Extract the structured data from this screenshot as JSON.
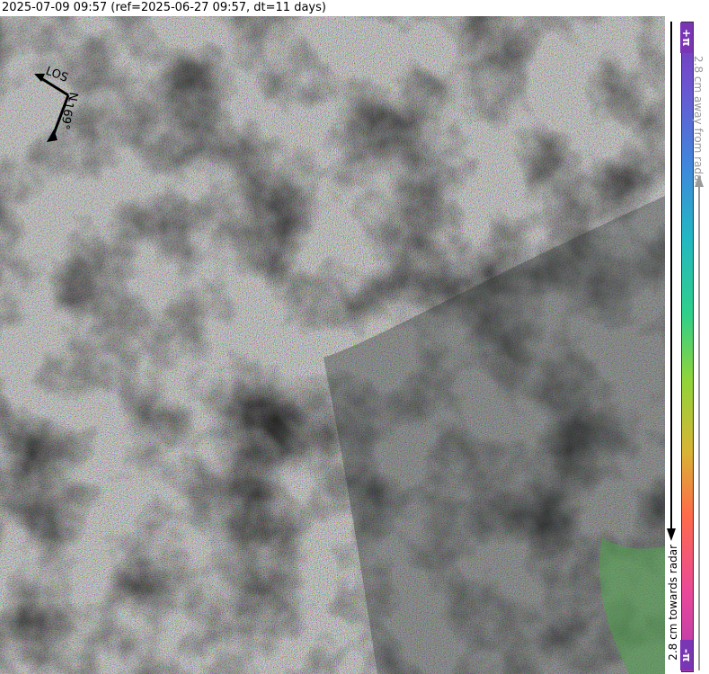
{
  "title": "2025-07-09 09:57 (ref=2025-06-27 09:57, dt=11 days)",
  "compass": {
    "los_label": "LOS",
    "north_label": "N",
    "heading_label": "-169°"
  },
  "colorbar": {
    "top_label": "+π",
    "bottom_label": "-π",
    "away_label": "2.8 cm away from radar",
    "towards_label": "2.8 cm towards radar",
    "top_color": "#7a35b5",
    "bottom_color": "#7a35b5",
    "away_arrow_color": "#9a9a9a",
    "towards_arrow_color": "#000000"
  },
  "map": {
    "description_color_base": "#5a5f58",
    "accent_green": "#4fa24a"
  }
}
